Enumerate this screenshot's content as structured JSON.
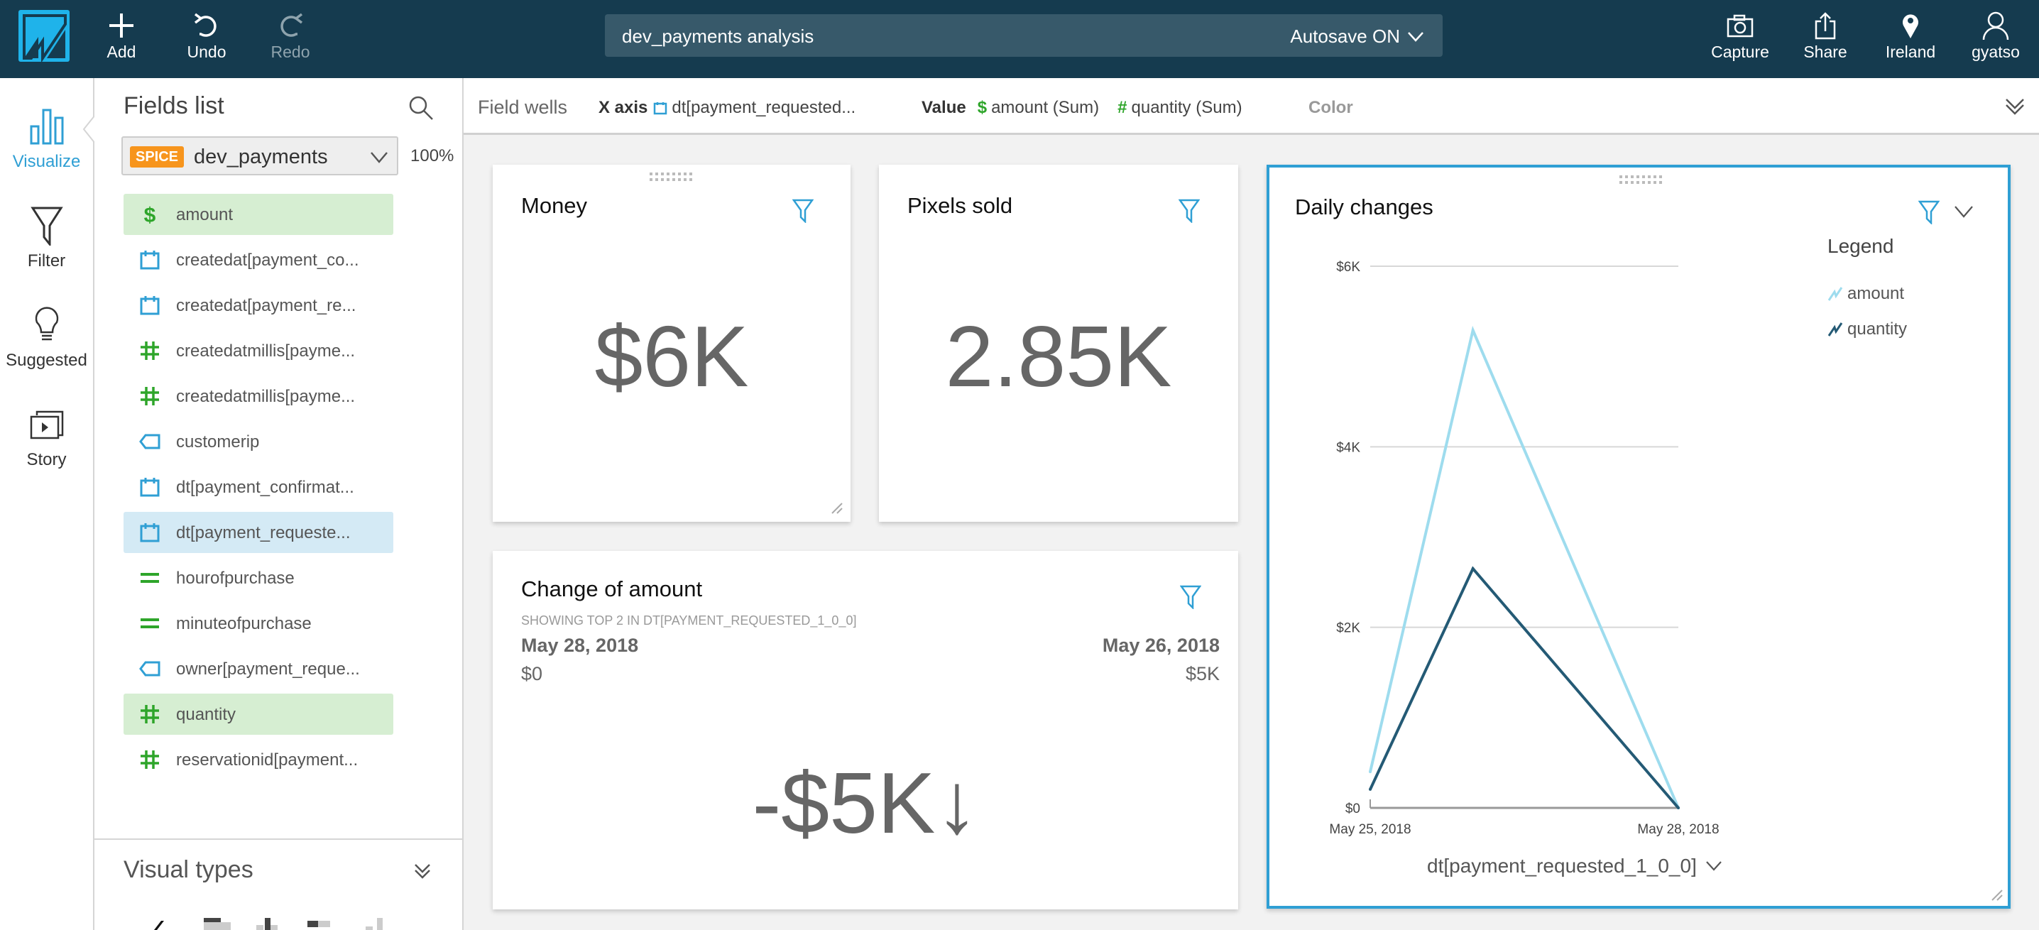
{
  "topbar": {
    "add_label": "Add",
    "undo_label": "Undo",
    "redo_label": "Redo",
    "analysis_title": "dev_payments analysis",
    "autosave_label": "Autosave ON",
    "capture_label": "Capture",
    "share_label": "Share",
    "region_label": "Ireland",
    "user_label": "gyatso"
  },
  "rail": {
    "items": [
      {
        "label": "Visualize",
        "icon": "bar-chart-icon",
        "active": true
      },
      {
        "label": "Filter",
        "icon": "filter-icon"
      },
      {
        "label": "Suggested",
        "icon": "lightbulb-icon"
      },
      {
        "label": "Story",
        "icon": "story-icon"
      }
    ]
  },
  "fields_panel": {
    "title": "Fields list",
    "dataset_badge": "SPICE",
    "dataset_name": "dev_payments",
    "import_percent": "100%",
    "fields": [
      {
        "label": "amount",
        "type": "currency",
        "state": "selected-measure"
      },
      {
        "label": "createdat[payment_co...",
        "type": "date"
      },
      {
        "label": "createdat[payment_re...",
        "type": "date"
      },
      {
        "label": "createdatmillis[payme...",
        "type": "number"
      },
      {
        "label": "createdatmillis[payme...",
        "type": "number"
      },
      {
        "label": "customerip",
        "type": "string"
      },
      {
        "label": "dt[payment_confirmat...",
        "type": "date"
      },
      {
        "label": "dt[payment_requeste...",
        "type": "date",
        "state": "selected-dimension"
      },
      {
        "label": "hourofpurchase",
        "type": "integer"
      },
      {
        "label": "minuteofpurchase",
        "type": "integer"
      },
      {
        "label": "owner[payment_reque...",
        "type": "string"
      },
      {
        "label": "quantity",
        "type": "number",
        "state": "selected-measure"
      },
      {
        "label": "reservationid[payment...",
        "type": "number"
      }
    ],
    "visual_types_title": "Visual types"
  },
  "field_wells": {
    "label": "Field wells",
    "x_axis_label": "X axis",
    "x_axis_field": "dt[payment_requested...",
    "value_label": "Value",
    "value_fields": [
      "amount (Sum)",
      "quantity (Sum)"
    ],
    "color_label": "Color"
  },
  "cards": {
    "money": {
      "title": "Money",
      "value": "$6K"
    },
    "pixels": {
      "title": "Pixels sold",
      "value": "2.85K"
    },
    "change": {
      "title": "Change of amount",
      "caption": "SHOWING TOP 2 IN DT[PAYMENT_REQUESTED_1_0_0]",
      "left_date": "May 28, 2018",
      "left_value": "$0",
      "right_date": "May 26, 2018",
      "right_value": "$5K",
      "delta": "-$5K↓"
    },
    "daily": {
      "title": "Daily changes",
      "legend_title": "Legend",
      "x_axis_title": "dt[payment_requested_1_0_0]"
    }
  },
  "colors": {
    "topbar": "#153b4f",
    "accent": "#2f9fd4",
    "amount_series": "#9edcee",
    "quantity_series": "#245a75",
    "spice_badge": "#f7951d",
    "measure_green": "#2ea52a"
  },
  "chart_data": {
    "type": "line",
    "title": "Daily changes",
    "xlabel": "dt[payment_requested_1_0_0]",
    "ylabel": "",
    "x": [
      "May 25, 2018",
      "May 26, 2018",
      "May 28, 2018"
    ],
    "x_day_offsets": [
      0,
      1,
      3
    ],
    "x_tick_labels": [
      "May 25, 2018",
      "May 28, 2018"
    ],
    "y_tick_labels": [
      "$0",
      "$2K",
      "$4K",
      "$6K"
    ],
    "y_ticks": [
      0,
      2000,
      4000,
      6000
    ],
    "ylim": [
      0,
      6000
    ],
    "grid": true,
    "legend_position": "right",
    "series": [
      {
        "name": "amount",
        "values": [
          400,
          5290,
          0
        ]
      },
      {
        "name": "quantity",
        "values": [
          205,
          2650,
          0
        ]
      }
    ]
  }
}
